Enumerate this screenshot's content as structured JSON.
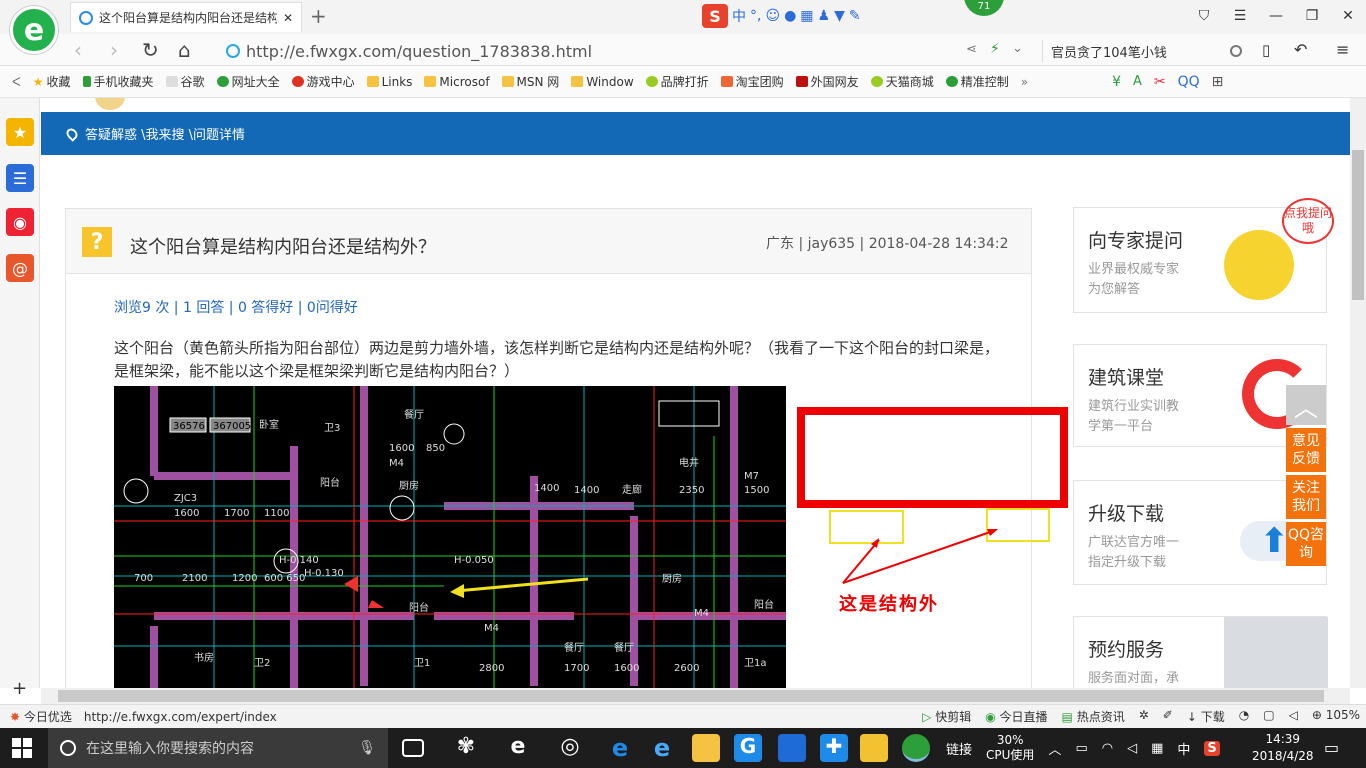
{
  "browser": {
    "tab_title": "这个阳台算是结构内阳台还是结构外",
    "new_tab": "+",
    "ime": {
      "lang": "中",
      "punct": "°,"
    },
    "badge": "71",
    "url": "http://e.fwxgx.com/question_1783838.html",
    "search_text": "官员贪了104笔小钱",
    "bookmarks": [
      "收藏",
      "手机收藏夹",
      "谷歌",
      "网址大全",
      "游戏中心",
      "Links",
      "Microsof",
      "MSN 网",
      "Window",
      "品牌打折",
      "淘宝团购",
      "外国网友",
      "天猫商城",
      "精准控制"
    ],
    "more": "»"
  },
  "page": {
    "breadcrumb": "答疑解惑 \\我来搜 \\问题详情",
    "question": {
      "title": "这个阳台算是结构内阳台还是结构外？",
      "meta": "广东 | jay635 | 2018-04-28 14:34:2",
      "stats": "浏览9 次 | 1 回答 | 0 答得好 | 0问得好",
      "body": "这个阳台（黄色箭头所指为阳台部位）两边是剪力墙外墙，该怎样判断它是结构内还是结构外呢？（我看了一下这个阳台的封口梁是，是框架梁，能不能以这个梁是框架梁判断它是结构内阳台？）",
      "annotation": "这是结构外"
    },
    "right_panel": [
      {
        "title": "向专家提问",
        "desc": [
          "业界最权威专家",
          "为您解答"
        ],
        "bubble": "点我提问哦"
      },
      {
        "title": "建筑课堂",
        "desc": [
          "建筑行业实训教",
          "学第一平台"
        ]
      },
      {
        "title": "升级下载",
        "desc": [
          "广联达官方唯一",
          "指定升级下载"
        ]
      },
      {
        "title": "预约服务",
        "desc": [
          "服务面对面，承"
        ]
      }
    ],
    "float_buttons": [
      "意见反馈",
      "关注我们",
      "QQ咨询"
    ]
  },
  "status": {
    "left": "今日优选",
    "link": "http://e.fwxgx.com/expert/index",
    "items": [
      "快剪辑",
      "今日直播",
      "热点资讯",
      "下载",
      "105%"
    ]
  },
  "taskbar": {
    "search_placeholder": "在这里输入你要搜索的内容",
    "tray": {
      "link": "链接",
      "cpu_pct": "30%",
      "cpu_label": "CPU使用",
      "ime": "中"
    },
    "time": "14:39",
    "date": "2018/4/28"
  },
  "colors": {
    "header_blue": "#1369b6",
    "accent_orange": "#f4720c",
    "annotation_red": "#e00000"
  }
}
